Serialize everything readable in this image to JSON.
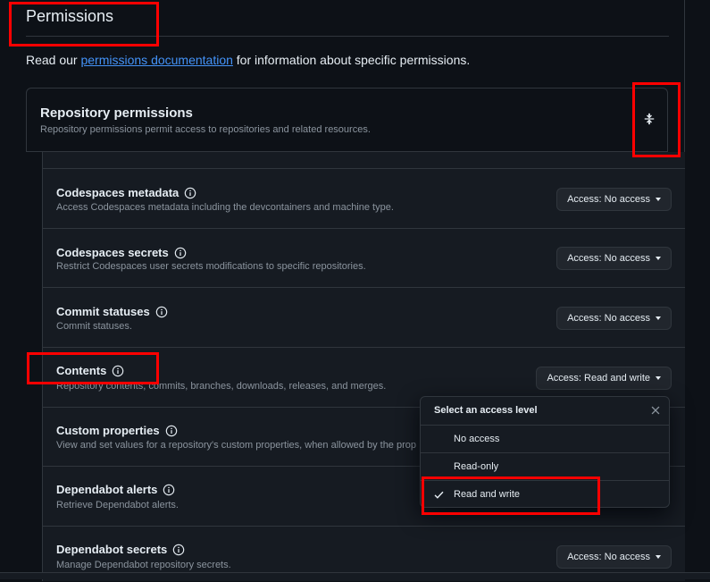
{
  "header": {
    "title": "Permissions",
    "intro_prefix": "Read our ",
    "intro_link": "permissions documentation",
    "intro_suffix": " for information about specific permissions."
  },
  "repository_permissions": {
    "title": "Repository permissions",
    "description": "Repository permissions permit access to repositories and related resources."
  },
  "permissions": [
    {
      "name": "Codespaces metadata",
      "description": "Access Codespaces metadata including the devcontainers and machine type.",
      "access": "Access: No access"
    },
    {
      "name": "Codespaces secrets",
      "description": "Restrict Codespaces user secrets modifications to specific repositories.",
      "access": "Access: No access"
    },
    {
      "name": "Commit statuses",
      "description": "Commit statuses.",
      "access": "Access: No access"
    },
    {
      "name": "Contents",
      "description": "Repository contents, commits, branches, downloads, releases, and merges.",
      "access": "Access: Read and write"
    },
    {
      "name": "Custom properties",
      "description": "View and set values for a repository's custom properties, when allowed by the prop",
      "access": ""
    },
    {
      "name": "Dependabot alerts",
      "description": "Retrieve Dependabot alerts.",
      "access": ""
    },
    {
      "name": "Dependabot secrets",
      "description": "Manage Dependabot repository secrets.",
      "access": "Access: No access"
    }
  ],
  "access_menu": {
    "title": "Select an access level",
    "options": [
      "No access",
      "Read-only",
      "Read and write"
    ],
    "selected": "Read and write"
  },
  "colors": {
    "background": "#0d1117",
    "panel": "#161b22",
    "border": "#30363d",
    "link": "#4493f8",
    "highlight": "#ff0000"
  },
  "icons": {
    "info": "info-icon",
    "collapse": "fold-icon",
    "close": "x-icon",
    "check": "check-icon",
    "caret": "triangle-down-icon"
  }
}
